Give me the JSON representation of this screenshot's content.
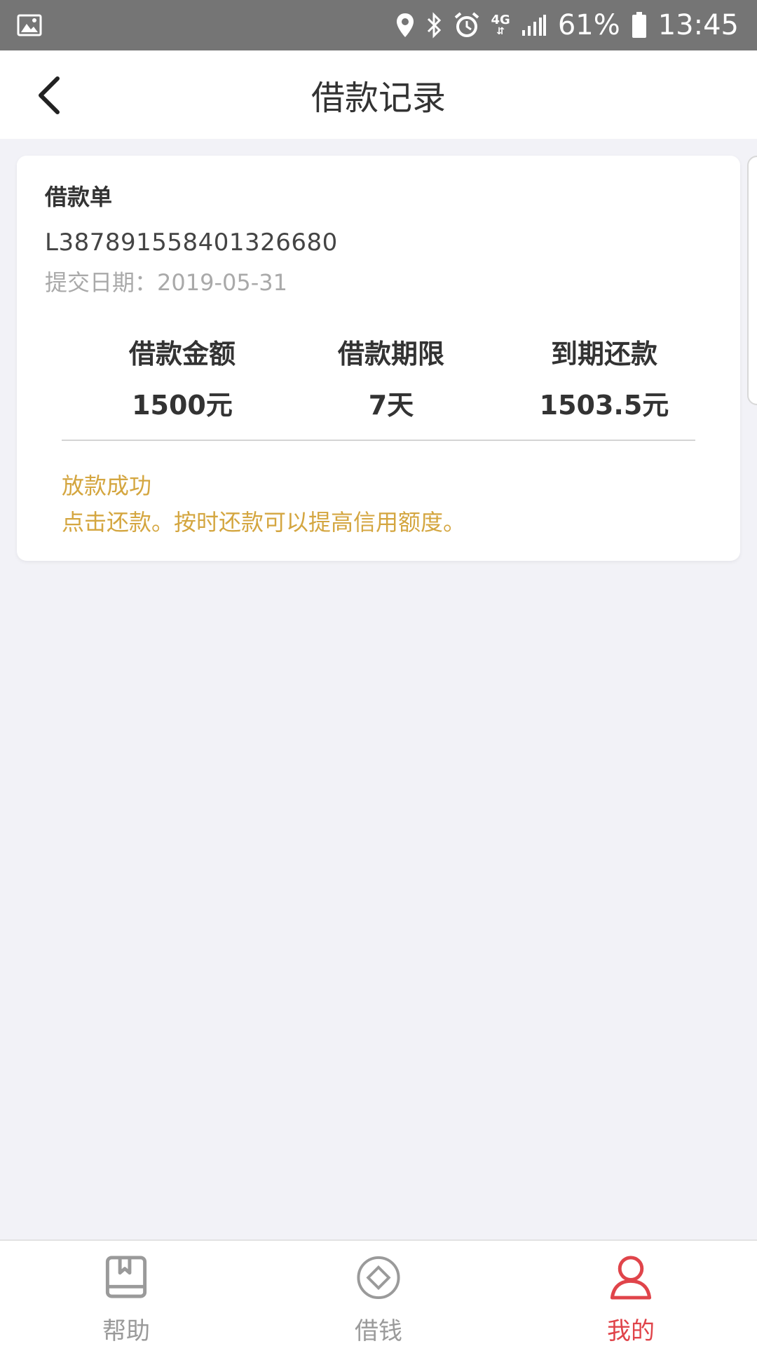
{
  "status_bar": {
    "network": "4G",
    "battery": "61%",
    "time": "13:45",
    "icons": [
      "image-icon",
      "location-icon",
      "bluetooth-icon",
      "alarm-icon",
      "signal-icon",
      "battery-icon"
    ]
  },
  "header": {
    "title": "借款记录",
    "back_icon": "chevron-left-icon"
  },
  "loan": {
    "card_title": "借款单",
    "number": "L387891558401326680",
    "submit_date_label": "提交日期：",
    "submit_date": "2019-05-31",
    "amount_label": "借款金额",
    "amount": "1500元",
    "term_label": "借款期限",
    "term": "7天",
    "due_label": "到期还款",
    "due": "1503.5元",
    "status": "放款成功",
    "status_desc": "点击还款。按时还款可以提高信用额度。",
    "status_color": "#d4a640"
  },
  "nav": {
    "items": [
      {
        "label": "帮助",
        "icon": "book-icon",
        "active": false
      },
      {
        "label": "借钱",
        "icon": "diamond-coin-icon",
        "active": false
      },
      {
        "label": "我的",
        "icon": "user-icon",
        "active": true
      }
    ],
    "active_color": "#e0444a",
    "inactive_color": "#9a9a9a"
  }
}
